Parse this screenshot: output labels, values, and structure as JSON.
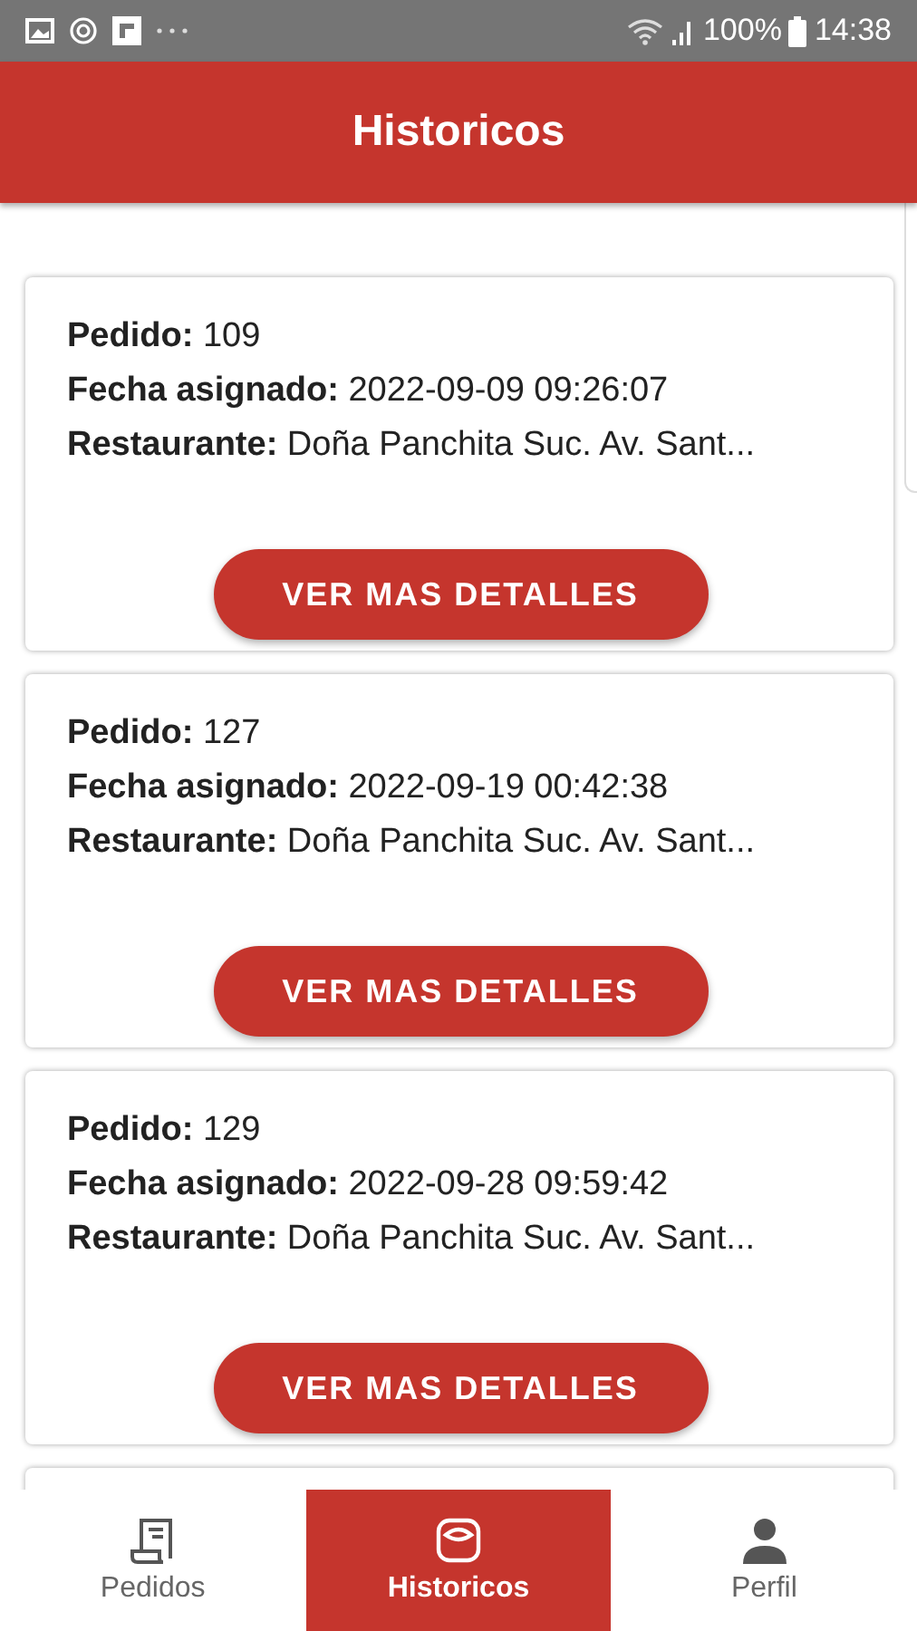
{
  "status_bar": {
    "battery": "100%",
    "time": "14:38"
  },
  "header": {
    "title": "Historicos"
  },
  "orders": [
    {
      "lines": [
        "**Pedido:** 109",
        "**Fecha asignado:** 2022-09-09 09:26:07",
        "**Restaurante:** Doña Panchita Suc. Av. Sant..."
      ],
      "button": "VER MAS DETALLES"
    },
    {
      "lines": [
        "**Pedido:** 127",
        "**Fecha asignado:** 2022-09-19 00:42:38",
        "**Restaurante:** Doña Panchita Suc. Av. Sant..."
      ],
      "button": "VER MAS DETALLES"
    },
    {
      "lines": [
        "**Pedido:** 129",
        "**Fecha asignado:** 2022-09-28 09:59:42",
        "**Restaurante:** Doña Panchita Suc. Av. Sant..."
      ],
      "button": "VER MAS DETALLES"
    }
  ],
  "nav": [
    {
      "label": "Pedidos",
      "kind": "receipt",
      "selected": false
    },
    {
      "label": "Historicos",
      "kind": "scale",
      "selected": true
    },
    {
      "label": "Perfil",
      "kind": "person",
      "selected": false
    }
  ]
}
